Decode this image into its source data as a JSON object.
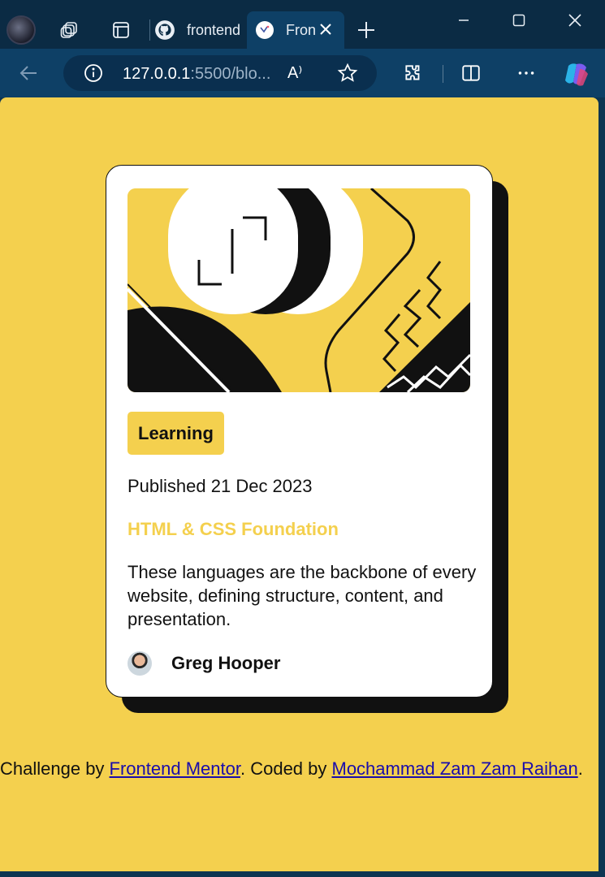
{
  "browser": {
    "tabs": [
      {
        "label": "frontend"
      },
      {
        "label": "Fron"
      }
    ],
    "address": {
      "host": "127.0.0.1",
      "rest": ":5500/blo...",
      "read_aloud": "A⁾"
    }
  },
  "card": {
    "category": "Learning",
    "published": "Published 21 Dec 2023",
    "title": "HTML & CSS Foundation",
    "description": "These languages are the backbone of every website, defining structure, content, and presentation.",
    "author": "Greg Hooper"
  },
  "attribution": {
    "prefix": "Challenge by ",
    "link1": "Frontend Mentor",
    "middle": ". Coded by ",
    "link2": "Mochammad Zam Zam Raihan",
    "suffix": "."
  },
  "colors": {
    "accent_yellow": "#f4d04e",
    "dark": "#111111",
    "browser_frame": "#0b2b44"
  }
}
